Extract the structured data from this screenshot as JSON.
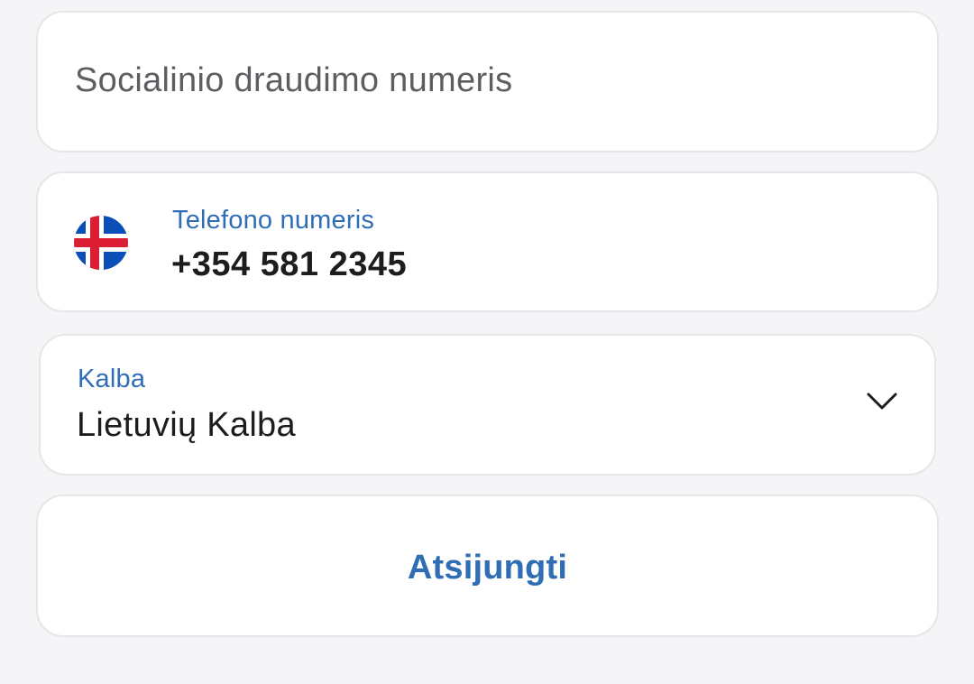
{
  "ssn_field": {
    "placeholder": "Socialinio draudimo numeris",
    "value": ""
  },
  "phone_field": {
    "label": "Telefono numeris",
    "value": "+354 581 2345",
    "country_flag_icon": "iceland-flag-icon"
  },
  "language_select": {
    "label": "Kalba",
    "selected": "Lietuvių Kalba",
    "icon": "chevron-down-icon"
  },
  "logout_button": {
    "label": "Atsijungti"
  },
  "colors": {
    "accent": "#2f6db5",
    "background": "#f5f5f7",
    "card": "#ffffff",
    "border": "#e6e6e8",
    "text": "#1d1d1f",
    "placeholder": "#5d5d62"
  }
}
